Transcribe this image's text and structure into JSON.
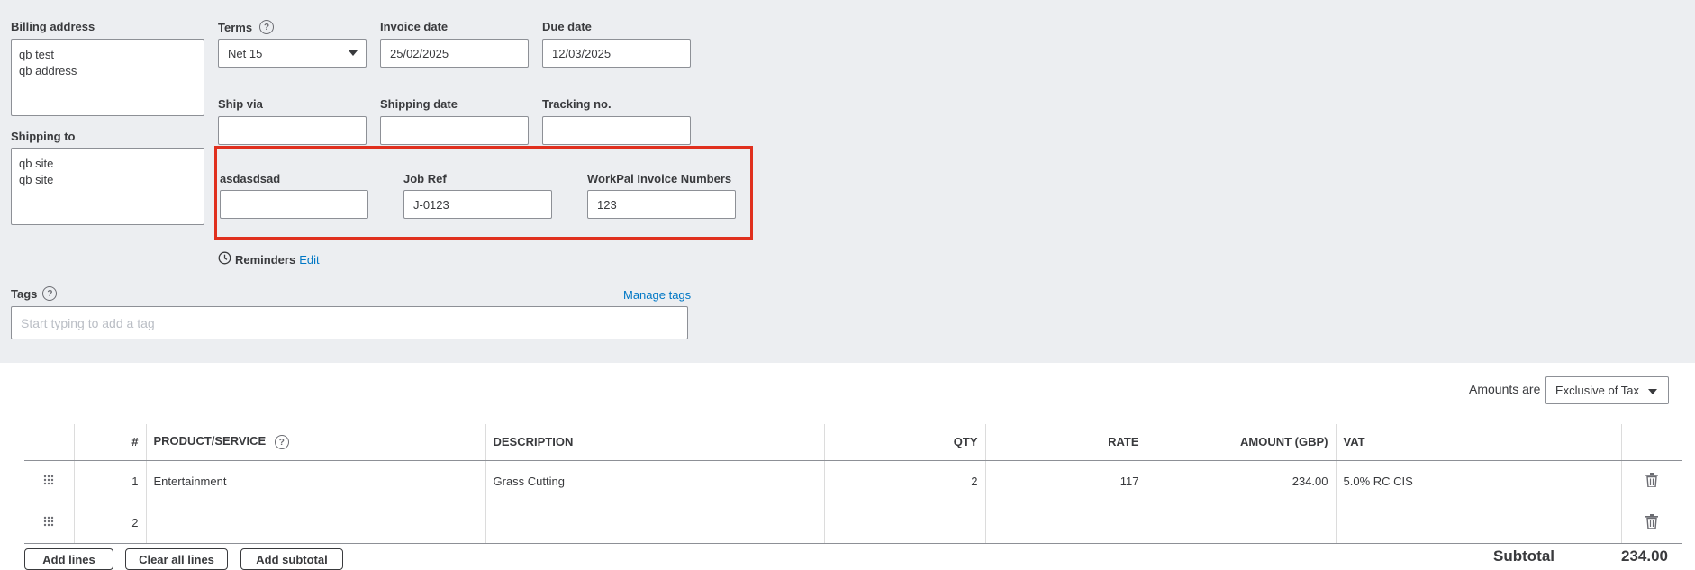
{
  "billing": {
    "label": "Billing address",
    "lines": [
      "qb test",
      "qb address"
    ]
  },
  "shipping_to": {
    "label": "Shipping to",
    "lines": [
      "qb site",
      "qb site"
    ]
  },
  "terms": {
    "label": "Terms",
    "value": "Net 15"
  },
  "invoice_date": {
    "label": "Invoice date",
    "value": "25/02/2025"
  },
  "due_date": {
    "label": "Due date",
    "value": "12/03/2025"
  },
  "ship_via": {
    "label": "Ship via",
    "value": ""
  },
  "shipping_date": {
    "label": "Shipping date",
    "value": ""
  },
  "tracking_no": {
    "label": "Tracking no.",
    "value": ""
  },
  "custom_fields": {
    "f1": {
      "label": "asdasdsad",
      "value": ""
    },
    "f2": {
      "label": "Job Ref",
      "value": "J-0123"
    },
    "f3": {
      "label": "WorkPal Invoice Numbers",
      "value": "123"
    }
  },
  "reminders": {
    "label": "Reminders",
    "edit": "Edit"
  },
  "tags": {
    "label": "Tags",
    "manage": "Manage tags",
    "placeholder": "Start typing to add a tag"
  },
  "amounts": {
    "label": "Amounts are",
    "value": "Exclusive of Tax"
  },
  "table": {
    "headers": {
      "num": "#",
      "product": "PRODUCT/SERVICE",
      "description": "DESCRIPTION",
      "qty": "QTY",
      "rate": "RATE",
      "amount": "AMOUNT (GBP)",
      "vat": "VAT"
    },
    "rows": [
      {
        "num": "1",
        "product": "Entertainment",
        "description": "Grass Cutting",
        "qty": "2",
        "rate": "117",
        "amount": "234.00",
        "vat": "5.0% RC CIS"
      },
      {
        "num": "2",
        "product": "",
        "description": "",
        "qty": "",
        "rate": "",
        "amount": "",
        "vat": ""
      }
    ]
  },
  "buttons": {
    "add_lines": "Add lines",
    "clear_all": "Clear all lines",
    "add_subtotal": "Add subtotal"
  },
  "subtotal": {
    "label": "Subtotal",
    "value": "234.00"
  },
  "colors": {
    "accent": "#0077c5",
    "highlight": "#e0301e",
    "panel": "#eceef1"
  }
}
